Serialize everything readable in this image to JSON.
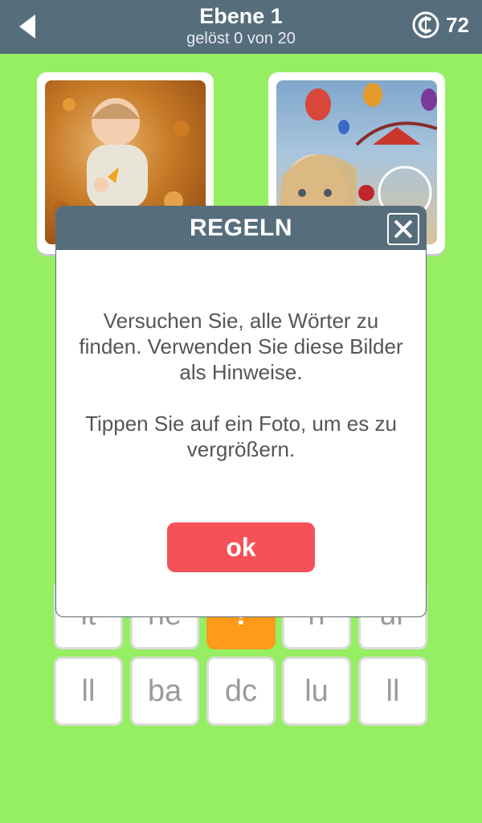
{
  "header": {
    "title": "Ebene 1",
    "subtitle": "gelöst 0 von 20",
    "coins": "72",
    "back_icon": "back-arrow-icon",
    "coin_icon": "coin-icon"
  },
  "colors": {
    "background": "#96ee63",
    "header": "#566d7c",
    "ok_button": "#f55158",
    "hint_tile": "#ff9a1a"
  },
  "photos": [
    {
      "name": "baby-autumn-leaves-photo"
    },
    {
      "name": "girl-balloons-fair-photo"
    }
  ],
  "tiles_row_partial": [
    "lt",
    "ne",
    "!",
    "n",
    "ur"
  ],
  "tiles_row_last": [
    "ll",
    "ba",
    "dc",
    "lu",
    "ll"
  ],
  "modal": {
    "title": "REGELN",
    "text1": "Versuchen Sie, alle Wörter zu finden. Verwenden Sie diese Bilder als Hinweise.",
    "text2": "Tippen Sie auf ein Foto, um es zu vergrößern.",
    "ok_label": "ok"
  }
}
